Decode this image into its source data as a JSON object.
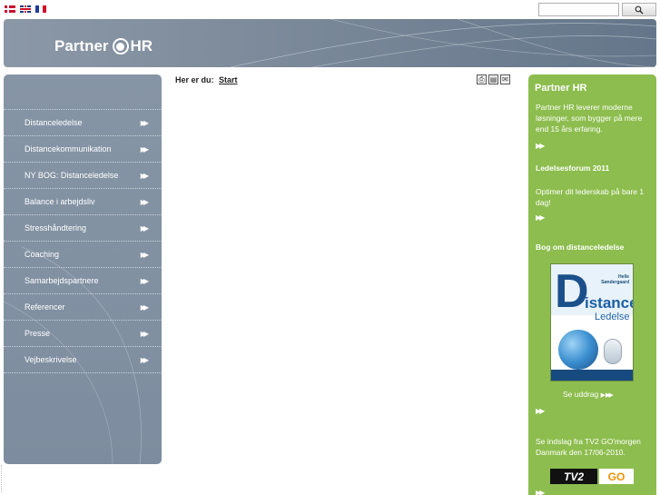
{
  "flags": [
    {
      "name": "danish-flag-icon",
      "cls": "flag-dk"
    },
    {
      "name": "uk-flag-icon",
      "cls": "flag-uk"
    },
    {
      "name": "french-flag-icon",
      "cls": "flag-fr"
    }
  ],
  "search": {
    "value": "",
    "placeholder": "",
    "button_icon": "magnifier-icon"
  },
  "header": {
    "logo_left": "Partner",
    "logo_right": "HR"
  },
  "breadcrumb": {
    "label": "Her er du:",
    "link": "Start"
  },
  "tool_icons": [
    "print-icon",
    "save-icon",
    "email-icon"
  ],
  "nav": {
    "items": [
      {
        "label": "Distanceledelse"
      },
      {
        "label": "Distancekommunikation"
      },
      {
        "label": "NY BOG: Distanceledelse"
      },
      {
        "label": "Balance i arbejdsliv"
      },
      {
        "label": "Stresshåndtering"
      },
      {
        "label": "Coaching"
      },
      {
        "label": "Samarbejdspartnere"
      },
      {
        "label": "Referencer"
      },
      {
        "label": "Presse"
      },
      {
        "label": "Vejbeskrivelse"
      }
    ],
    "arrow_glyph": "▶▶"
  },
  "right": {
    "title": "Partner HR",
    "intro": "Partner HR leverer moderne løsninger, som bygger på mere end 15 års erfaring.",
    "forum_title": "Ledelsesforum 2011",
    "forum_text": "Optimer dit lederskab på bare 1 dag!",
    "book_title": "Bog om distanceledelse",
    "book_cover": {
      "author_first": "Helle",
      "author_last": "Søndergaard",
      "big_letter": "D",
      "word1": "istance",
      "word2": "Ledelse"
    },
    "excerpt_link": "Se uddrag",
    "tv_text": "Se indslag fra TV2 GO'morgen Danmark den 17/06-2010.",
    "tv_logo_left": "TV2",
    "tv_logo_right": "GO",
    "more_glyph": "▶▶"
  },
  "colors": {
    "nav_bg": "#8695a5",
    "banner_bg": "#7e8c9c",
    "right_bg": "#8dbd4e"
  }
}
